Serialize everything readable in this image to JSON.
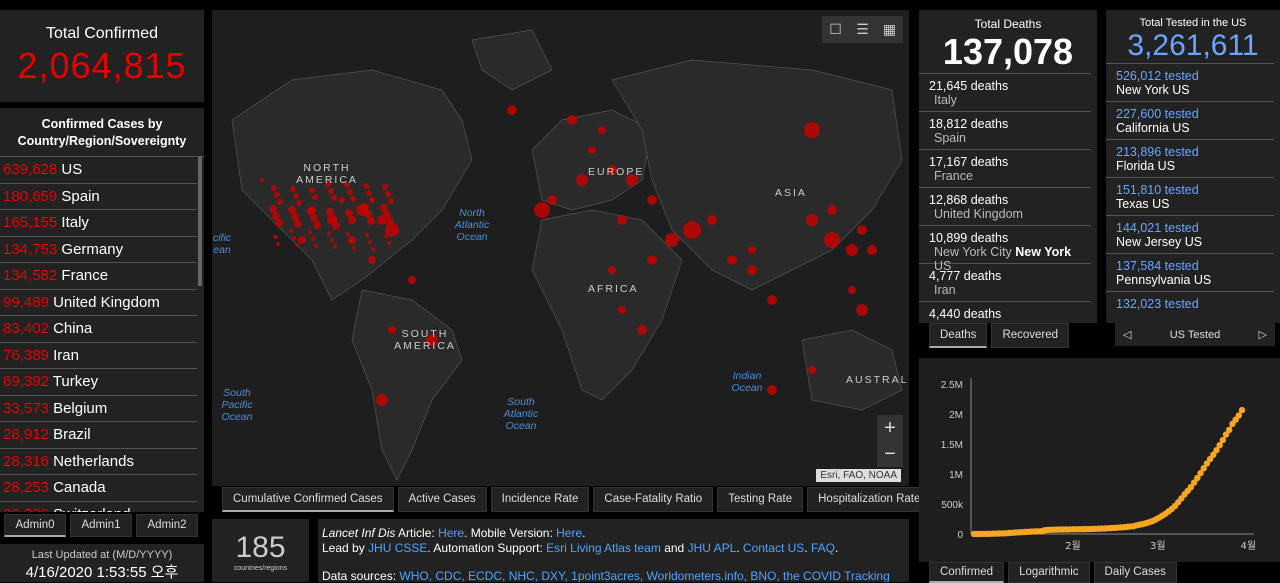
{
  "total_confirmed": {
    "title": "Total Confirmed",
    "value": "2,064,815"
  },
  "country_list": {
    "header": "Confirmed Cases by Country/Region/Sovereignty",
    "rows": [
      {
        "n": "639,628",
        "c": "US"
      },
      {
        "n": "180,659",
        "c": "Spain"
      },
      {
        "n": "165,155",
        "c": "Italy"
      },
      {
        "n": "134,753",
        "c": "Germany"
      },
      {
        "n": "134,582",
        "c": "France"
      },
      {
        "n": "99,489",
        "c": "United Kingdom"
      },
      {
        "n": "83,402",
        "c": "China"
      },
      {
        "n": "76,389",
        "c": "Iran"
      },
      {
        "n": "69,392",
        "c": "Turkey"
      },
      {
        "n": "33,573",
        "c": "Belgium"
      },
      {
        "n": "28,912",
        "c": "Brazil"
      },
      {
        "n": "28,316",
        "c": "Netherlands"
      },
      {
        "n": "28,253",
        "c": "Canada"
      },
      {
        "n": "26,336",
        "c": "Switzerland"
      }
    ]
  },
  "admin_tabs": [
    "Admin0",
    "Admin1",
    "Admin2"
  ],
  "last_updated": {
    "label": "Last Updated at (M/D/YYYY)",
    "value": "4/16/2020 1:53:55 오후"
  },
  "map": {
    "labels": {
      "na": "NORTH AMERICA",
      "sa": "SOUTH AMERICA",
      "eu": "EUROPE",
      "af": "AFRICA",
      "as": "ASIA",
      "au": "AUSTRAL"
    },
    "oceans": {
      "nao": "North Atlantic Ocean",
      "spo": "South Pacific Ocean",
      "sao": "South Atlantic Ocean",
      "io": "Indian Ocean",
      "pac": "cific ean"
    },
    "attribution": "Esri, FAO, NOAA",
    "zoom_in": "+",
    "zoom_out": "−",
    "tabs": [
      "Cumulative Confirmed Cases",
      "Active Cases",
      "Incidence Rate",
      "Case-Fatality Ratio",
      "Testing Rate",
      "Hospitalization Rate"
    ]
  },
  "countries_count": {
    "value": "185",
    "label": "countries/regions"
  },
  "info": {
    "l1a": "Lancet Inf Dis",
    "l1b": " Article: ",
    "l1c": "Here",
    "l1d": ". Mobile Version: ",
    "l1e": "Here",
    "l1f": ".",
    "l2a": "Lead by ",
    "l2b": "JHU CSSE",
    "l2c": ". Automation Support: ",
    "l2d": "Esri Living Atlas team",
    "l2e": " and ",
    "l2f": "JHU APL",
    "l2g": ". ",
    "l2h": "Contact US",
    "l2i": ". ",
    "l2j": "FAQ",
    "l2k": ".",
    "l3a": "Data sources: ",
    "l3b": "WHO, CDC, ECDC, NHC, DXY, 1point3acres, Worldometers.info, BNO, the COVID Tracking"
  },
  "deaths": {
    "title": "Total Deaths",
    "value": "137,078",
    "rows": [
      {
        "n": "21,645 deaths",
        "c": "Italy"
      },
      {
        "n": "18,812 deaths",
        "c": "Spain"
      },
      {
        "n": "17,167 deaths",
        "c": "France"
      },
      {
        "n": "12,868 deaths",
        "c": "United Kingdom"
      },
      {
        "n": "10,899 deaths",
        "c": "New York City ",
        "b": "New York",
        "s": " US"
      },
      {
        "n": "4,777 deaths",
        "c": "Iran"
      },
      {
        "n": "4,440 deaths",
        "c": ""
      }
    ],
    "tabs": [
      "Deaths",
      "Recovered"
    ]
  },
  "tested": {
    "title": "Total Tested in the US",
    "value": "3,261,611",
    "rows": [
      {
        "n": "526,012 tested",
        "c": "New York US"
      },
      {
        "n": "227,600 tested",
        "c": "California US"
      },
      {
        "n": "213,896 tested",
        "c": "Florida US"
      },
      {
        "n": "151,810 tested",
        "c": "Texas US"
      },
      {
        "n": "144,021 tested",
        "c": "New Jersey US"
      },
      {
        "n": "137,584 tested",
        "c": "Pennsylvania US"
      },
      {
        "n": "132,023 tested",
        "c": ""
      }
    ],
    "nav_label": "US Tested",
    "prev": "◁",
    "next": "▷"
  },
  "chart_data": {
    "type": "line",
    "title": "",
    "xlabel": "",
    "ylabel": "",
    "x_ticks": [
      "2월",
      "3월",
      "4월"
    ],
    "y_ticks": [
      "0",
      "500k",
      "1M",
      "1.5M",
      "2M",
      "2.5M"
    ],
    "ylim": [
      0,
      2500000
    ],
    "color": "#f5a623",
    "values": [
      555,
      654,
      941,
      1434,
      2118,
      2927,
      5578,
      6166,
      8234,
      9927,
      12038,
      16787,
      19881,
      23892,
      27635,
      30817,
      34391,
      37120,
      40150,
      42762,
      44802,
      45221,
      60368,
      66885,
      69030,
      71224,
      73258,
      75136,
      75639,
      76197,
      76819,
      78572,
      78958,
      79561,
      80406,
      81388,
      82746,
      84112,
      86011,
      88369,
      90306,
      92840,
      95120,
      97886,
      101801,
      105847,
      109821,
      113590,
      118620,
      125875,
      128352,
      145205,
      156101,
      167454,
      181574,
      197102,
      214821,
      242570,
      272208,
      304507,
      336953,
      378235,
      418045,
      467653,
      529591,
      593291,
      660706,
      720117,
      782365,
      857487,
      932605,
      1013466,
      1095917,
      1176060,
      1249754,
      1321481,
      1396476,
      1480202,
      1565278,
      1657526,
      1735650,
      1834721,
      1904838,
      1976191,
      2064815
    ],
    "tabs": [
      "Confirmed",
      "Logarithmic",
      "Daily Cases"
    ]
  }
}
